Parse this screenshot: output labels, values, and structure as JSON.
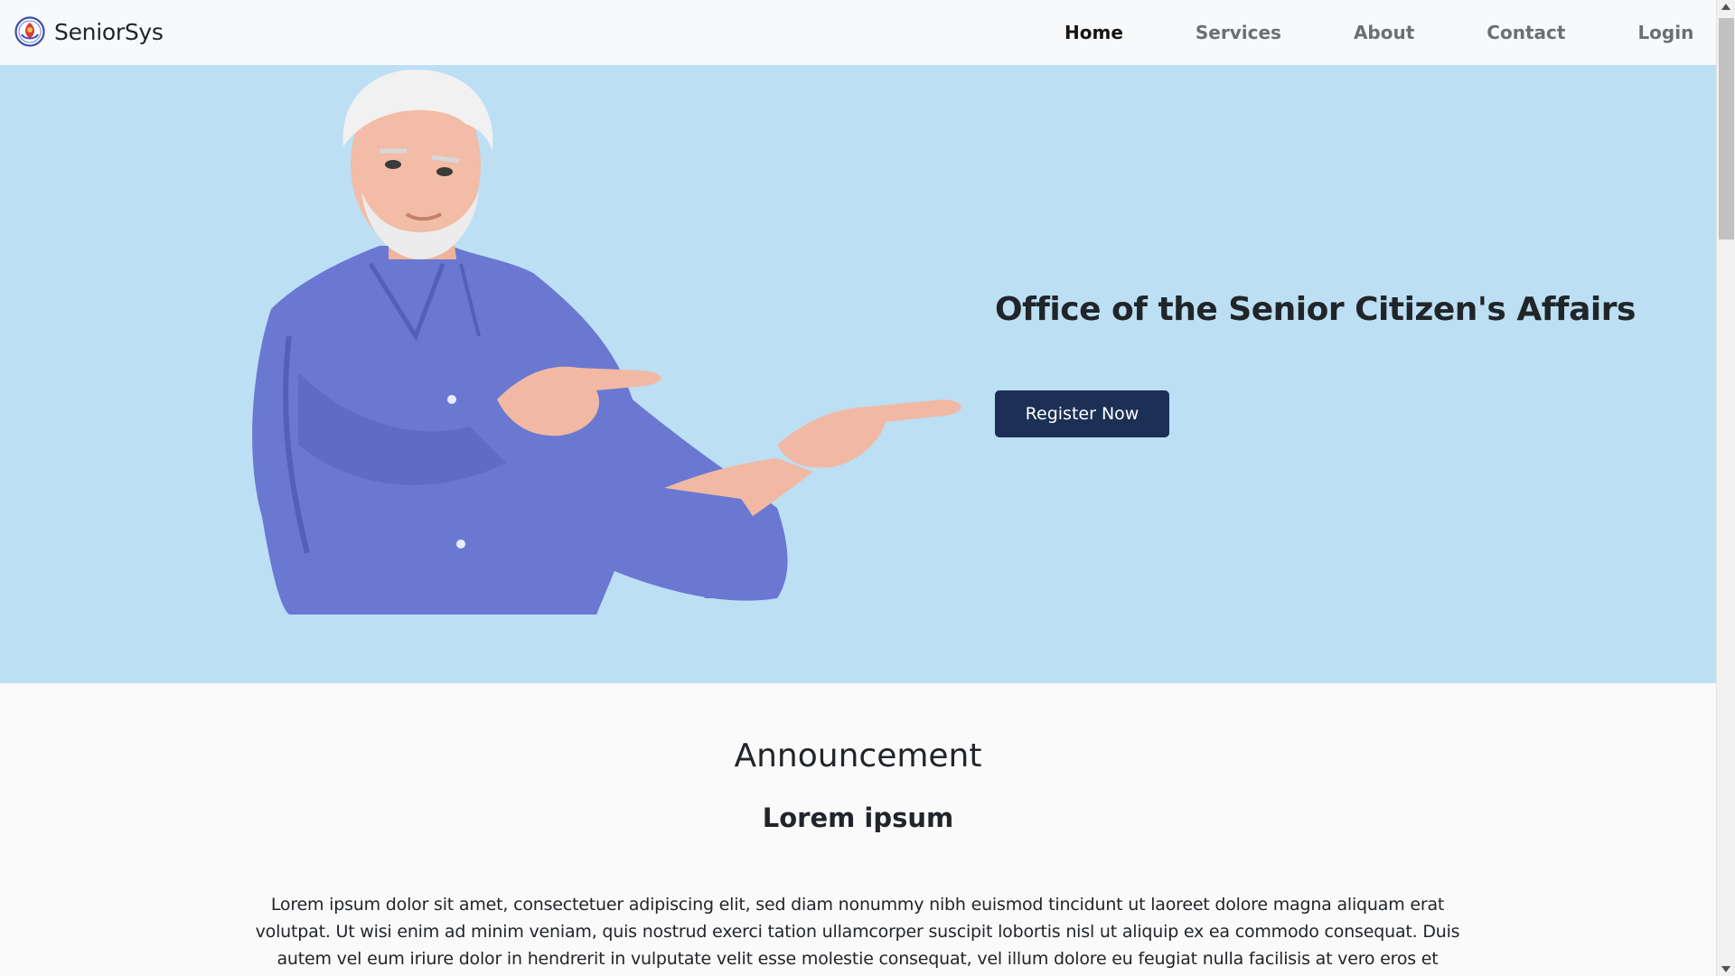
{
  "navbar": {
    "brand_name": "SeniorSys",
    "logo_icon": "senior-care-logo-icon",
    "links": [
      {
        "label": "Home",
        "active": true
      },
      {
        "label": "Services",
        "active": false
      },
      {
        "label": "About",
        "active": false
      },
      {
        "label": "Contact",
        "active": false
      },
      {
        "label": "Login",
        "active": false
      }
    ]
  },
  "hero": {
    "title": "Office of the Senior Citizen's Affairs",
    "cta_label": "Register Now",
    "background_color": "#bcdff4",
    "cta_color": "#1b3054"
  },
  "announcement": {
    "title": "Announcement",
    "subtitle": "Lorem ipsum",
    "body": "Lorem ipsum dolor sit amet, consectetuer adipiscing elit, sed diam nonummy nibh euismod tincidunt ut laoreet dolore magna aliquam erat volutpat. Ut wisi enim ad minim veniam, quis nostrud exerci tation ullamcorper suscipit lobortis nisl ut aliquip ex ea commodo consequat. Duis autem vel eum iriure dolor in hendrerit in vulputate velit esse molestie consequat, vel illum dolore eu feugiat nulla facilisis at vero eros et accumsan et iusto odio dignissim qui blandit"
  }
}
